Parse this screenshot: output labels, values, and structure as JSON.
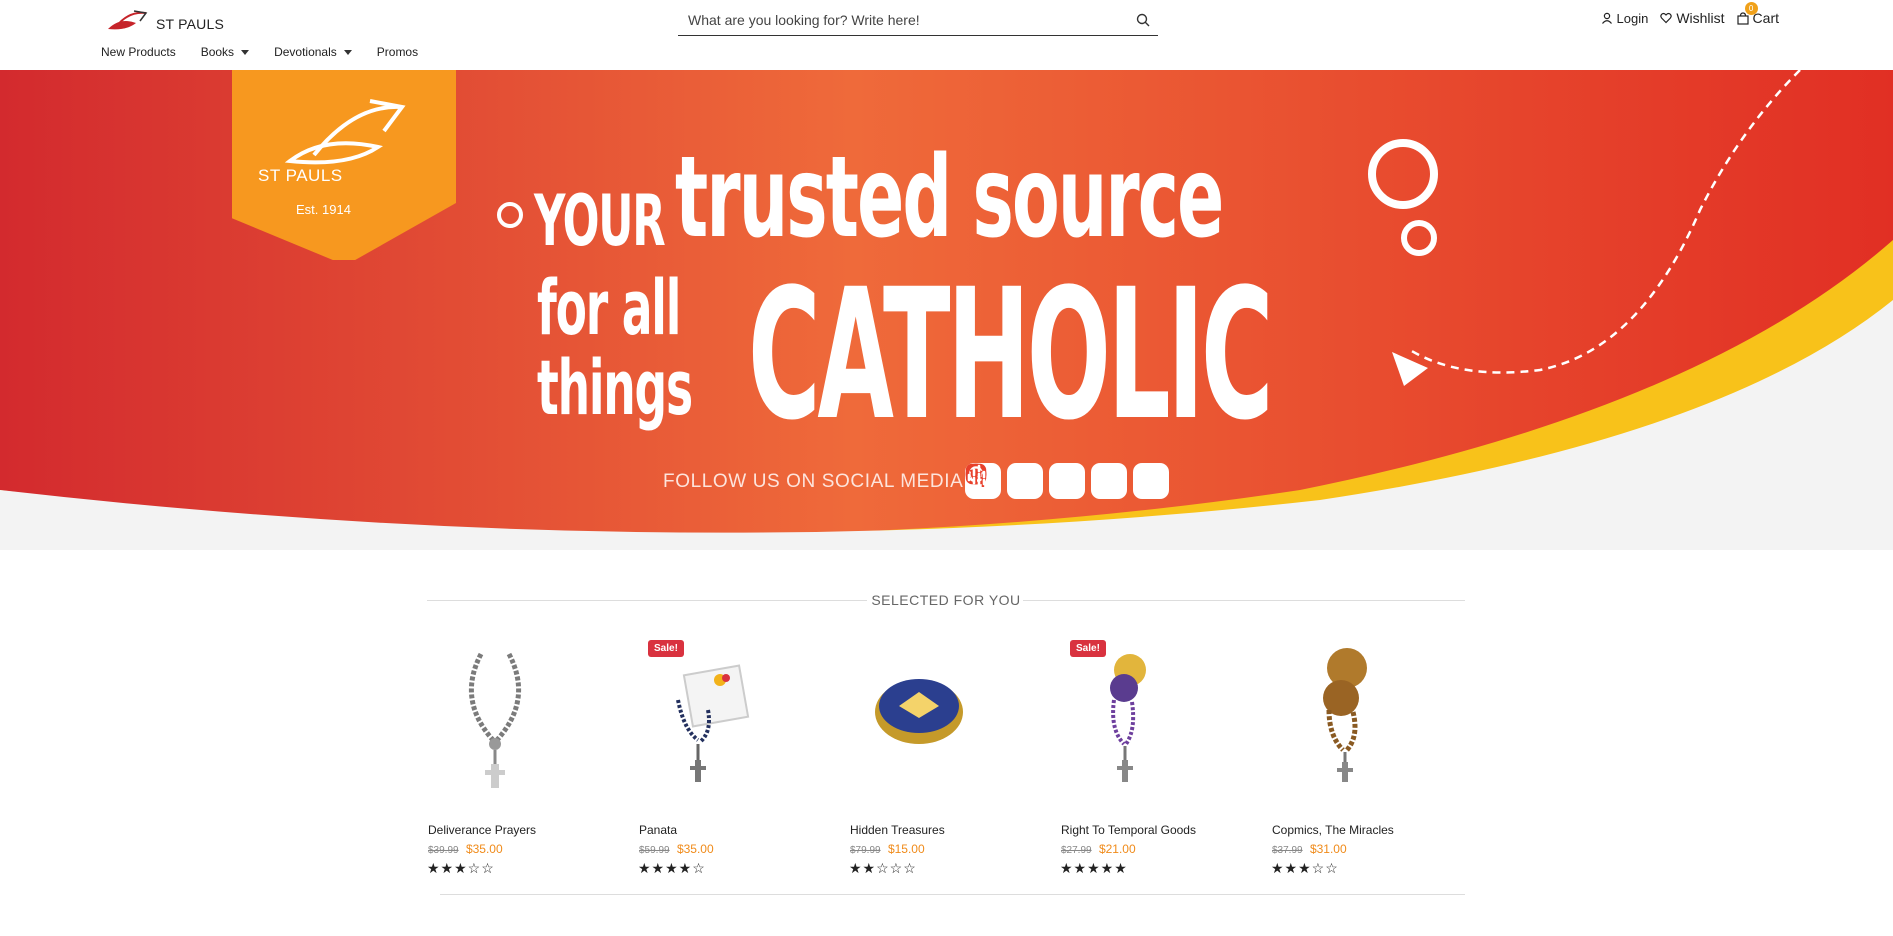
{
  "brand": {
    "logo_text": "ST PAULS"
  },
  "search": {
    "placeholder": "What are you looking for? Write here!"
  },
  "account": {
    "login": "Login",
    "wishlist": "Wishlist",
    "cart": "Cart",
    "cart_count": "0"
  },
  "nav": {
    "items": [
      {
        "label": "New Products",
        "has_dropdown": false
      },
      {
        "label": "Books",
        "has_dropdown": true
      },
      {
        "label": "Devotionals",
        "has_dropdown": true
      },
      {
        "label": "Promos",
        "has_dropdown": false
      }
    ]
  },
  "hero": {
    "badge_brand": "ST PAULS",
    "badge_est": "Est. 1914",
    "line_your": "YOUR",
    "line_trusted": "trusted source",
    "line_forall": "for all",
    "line_things": "things",
    "line_catholic": "CATHOLIC",
    "follow": "FOLLOW US ON SOCIAL MEDIA",
    "social_icons": [
      "facebook-icon",
      "instagram-icon",
      "spotify-icon",
      "youtube-icon",
      "podcast-icon",
      "audio-wave-icon"
    ],
    "slide_count": 6,
    "active_slide": 1,
    "colors": {
      "red": "#e8402b",
      "orange": "#f7981f",
      "yellow": "#f8c21a"
    }
  },
  "section": {
    "title": "SELECTED FOR YOU"
  },
  "products": [
    {
      "name": "Deliverance Prayers",
      "old_price": "$39.99",
      "price": "$35.00",
      "rating": 3,
      "sale": false,
      "sale_label": ""
    },
    {
      "name": "Panata",
      "old_price": "$59.99",
      "price": "$35.00",
      "rating": 4,
      "sale": true,
      "sale_label": "Sale!"
    },
    {
      "name": "Hidden Treasures",
      "old_price": "$79.99",
      "price": "$15.00",
      "rating": 2,
      "sale": false,
      "sale_label": ""
    },
    {
      "name": "Right To Temporal Goods",
      "old_price": "$27.99",
      "price": "$21.00",
      "rating": 5,
      "sale": true,
      "sale_label": "Sale!"
    },
    {
      "name": "Copmics, The Miracles",
      "old_price": "$37.99",
      "price": "$31.00",
      "rating": 3,
      "sale": false,
      "sale_label": ""
    }
  ]
}
